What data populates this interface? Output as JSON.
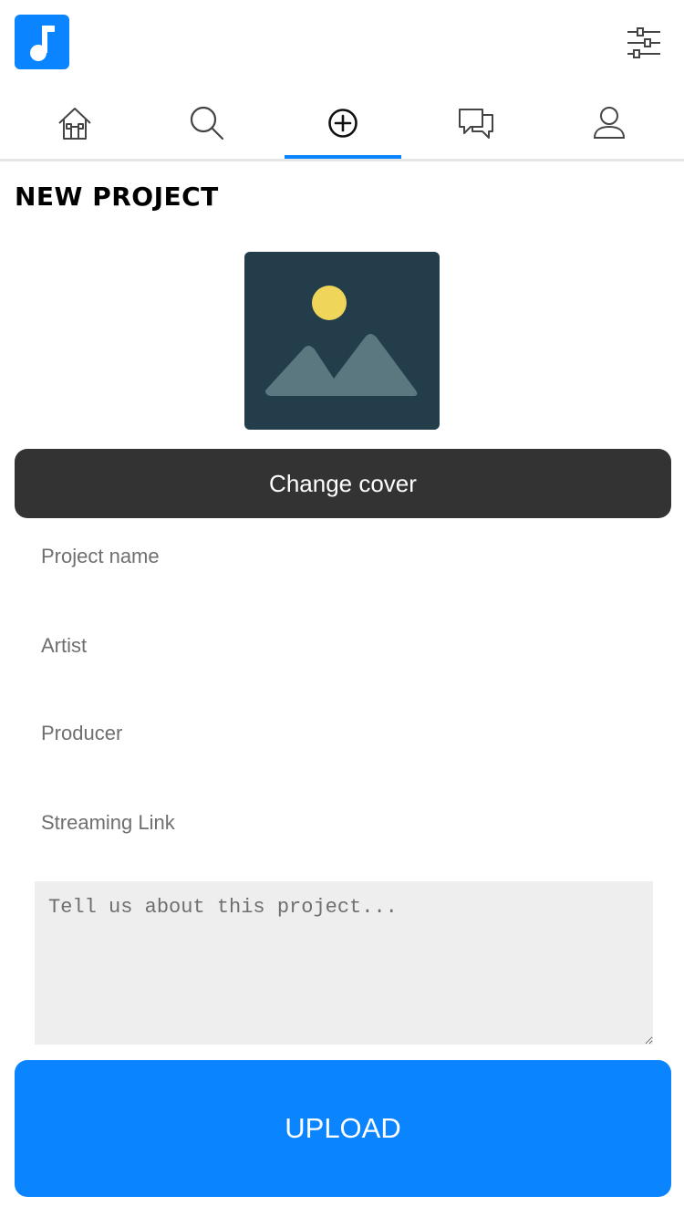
{
  "app": {
    "logo_icon": "music-note-icon",
    "brand_color": "#0a84ff",
    "filter_icon": "sliders-icon"
  },
  "tabs": [
    {
      "name": "home",
      "icon": "home-icon",
      "active": false
    },
    {
      "name": "search",
      "icon": "search-icon",
      "active": false
    },
    {
      "name": "create",
      "icon": "plus-circle-icon",
      "active": true
    },
    {
      "name": "messages",
      "icon": "chat-icon",
      "active": false
    },
    {
      "name": "profile",
      "icon": "user-icon",
      "active": false
    }
  ],
  "page": {
    "title": "NEW PROJECT"
  },
  "cover": {
    "icon": "image-placeholder-icon",
    "change_label": "Change cover"
  },
  "form": {
    "project_name_placeholder": "Project name",
    "artist_placeholder": "Artist",
    "producer_placeholder": "Producer",
    "streaming_link_placeholder": "Streaming Link",
    "description_placeholder": "Tell us about this project..."
  },
  "actions": {
    "upload_label": "UPLOAD"
  }
}
